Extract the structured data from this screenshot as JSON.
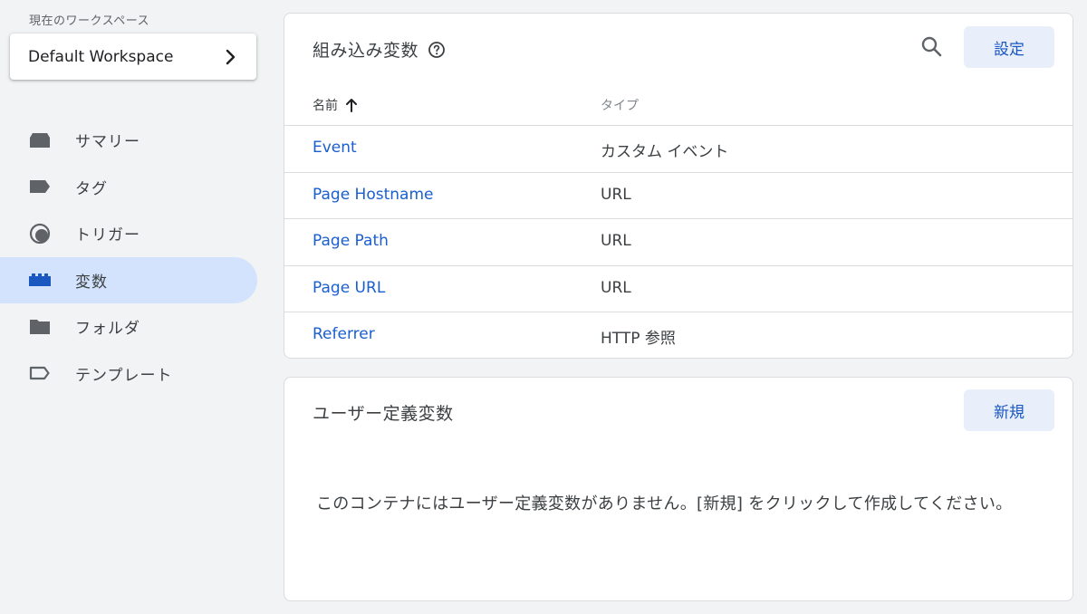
{
  "sidebar": {
    "workspace_label": "現在のワークスペース",
    "workspace_name": "Default Workspace",
    "items": [
      {
        "label": "サマリー",
        "icon": "overview-icon"
      },
      {
        "label": "タグ",
        "icon": "tag-icon"
      },
      {
        "label": "トリガー",
        "icon": "trigger-icon"
      },
      {
        "label": "変数",
        "icon": "variables-icon",
        "active": true
      },
      {
        "label": "フォルダ",
        "icon": "folder-icon"
      },
      {
        "label": "テンプレート",
        "icon": "template-icon"
      }
    ]
  },
  "builtin": {
    "title": "組み込み変数",
    "configure_label": "設定",
    "columns": {
      "name": "名前",
      "type": "タイプ"
    },
    "rows": [
      {
        "name": "Event",
        "type": "カスタム イベント"
      },
      {
        "name": "Page Hostname",
        "type": "URL"
      },
      {
        "name": "Page Path",
        "type": "URL"
      },
      {
        "name": "Page URL",
        "type": "URL"
      },
      {
        "name": "Referrer",
        "type": "HTTP 参照"
      }
    ]
  },
  "user_defined": {
    "title": "ユーザー定義変数",
    "new_label": "新規",
    "empty_message": "このコンテナにはユーザー定義変数がありません。[新規] をクリックして作成してください。"
  },
  "colors": {
    "accent": "#1a73e8",
    "link": "#1a5fd0",
    "active_nav_bg": "#d3e3fd",
    "button_bg": "#e8effa"
  }
}
